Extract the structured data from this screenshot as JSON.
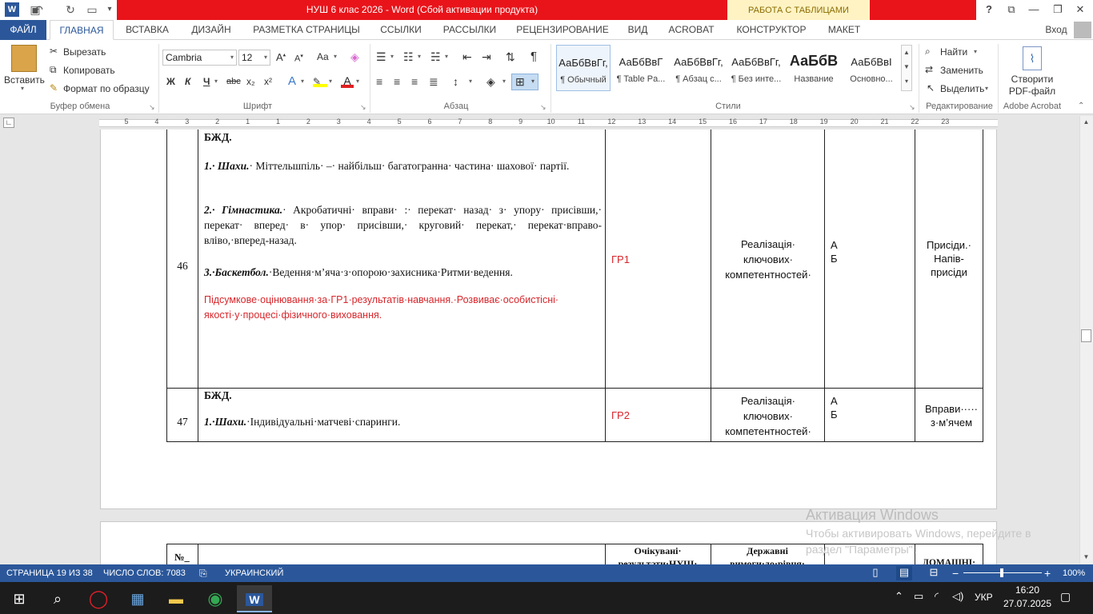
{
  "window": {
    "title": "НУШ 6 клас 2026 -  Word (Сбой активации продукта)",
    "context_tab": "РАБОТА С ТАБЛИЦАМИ",
    "help": "?",
    "signin": "Вход"
  },
  "tabs": [
    "ФАЙЛ",
    "ГЛАВНАЯ",
    "ВСТАВКА",
    "ДИЗАЙН",
    "РАЗМЕТКА СТРАНИЦЫ",
    "ССЫЛКИ",
    "РАССЫЛКИ",
    "РЕЦЕНЗИРОВАНИЕ",
    "ВИД",
    "ACROBAT",
    "КОНСТРУКТОР",
    "МАКЕТ"
  ],
  "clipboard": {
    "paste": "Вставить",
    "cut": "Вырезать",
    "copy": "Копировать",
    "format_painter": "Формат по образцу",
    "label": "Буфер обмена"
  },
  "font": {
    "name": "Cambria",
    "size": "12",
    "label": "Шрифт",
    "bold": "Ж",
    "italic": "К",
    "underline": "Ч",
    "strike": "abc",
    "sub": "x₂",
    "sup": "x²",
    "case": "Aa"
  },
  "paragraph": {
    "label": "Абзац"
  },
  "styles": {
    "label": "Стили",
    "items": [
      {
        "preview": "АаБбВвГг,",
        "name": "¶ Обычный"
      },
      {
        "preview": "АаБбВвГ",
        "name": "¶ Table Pa..."
      },
      {
        "preview": "АаБбВвГг,",
        "name": "¶ Абзац с..."
      },
      {
        "preview": "АаБбВвГг,",
        "name": "¶ Без инте..."
      },
      {
        "preview": "АаБбВ",
        "name": "Название"
      },
      {
        "preview": "АаБбВвІ",
        "name": "Основно..."
      }
    ]
  },
  "editing": {
    "find": "Найти",
    "replace": "Заменить",
    "select": "Выделить",
    "label": "Редактирование"
  },
  "acrobat": {
    "create_pdf_line1": "Створити",
    "create_pdf_line2": "PDF-файл",
    "label": "Adobe Acrobat"
  },
  "ruler_numbers": [
    "5",
    "4",
    "3",
    "2",
    "1",
    "1",
    "2",
    "3",
    "4",
    "5",
    "6",
    "7",
    "8",
    "9",
    "10",
    "11",
    "12",
    "13",
    "14",
    "15",
    "16",
    "17",
    "18",
    "19",
    "20",
    "21",
    "22",
    "23"
  ],
  "rows": [
    {
      "num": "46",
      "heading": "БЖД.",
      "p1_bold": "1.· Шахи.",
      "p1_text": "· Міттельшпіль· –· найбільш· багатогранна· частина· шахової· партії.",
      "p2_bold": "2.· Гімнастика.",
      "p2_text": "· Акробатичні· вправи· :· перекат· назад· з· упору· присівши,· перекат· вперед· в· упор· присівши,· круговий· перекат,· перекат·вправо-вліво,·вперед-назад.",
      "p3_bold": "3.·Баскетбол.",
      "p3_text": "·Ведення·м’яча·з·опорою·захисника·Ритми·ведення.",
      "p4": "Підсумкове·оцінювання·за·ГР1·результатів·навчання.·Розвиває·особистісні· якості·у·процесі·фізичного·виховання.",
      "group": "ГР1",
      "requirement": "Реалізація· ключових· компетентностей·",
      "level_a": "А",
      "level_b": "Б",
      "homework": "Присіди.· Напів- присіди"
    },
    {
      "num": "47",
      "heading": "БЖД.",
      "p1_bold": "1.·Шахи.",
      "p1_text": "·Індивідуальні·матчеві·спаринги.",
      "group": "ГР2",
      "requirement": "Реалізація· ключових· компетентностей·",
      "level_a": "А",
      "level_b": "Б",
      "homework": "Вправи····· з·м’ячем"
    }
  ],
  "next_header": {
    "num": "№_",
    "expected": "Очікувані· результати·НУШ·",
    "state": "Державні вимоги·до·рівня·",
    "homework": "ДОМАШНІ·"
  },
  "activation": {
    "title": "Активация Windows",
    "text": "Чтобы активировать Windows, перейдите в раздел \"Параметры\"."
  },
  "status": {
    "page": "СТРАНИЦА 19 ИЗ 38",
    "words": "ЧИСЛО СЛОВ: 7083",
    "language": "УКРАИНСКИЙ",
    "zoom": "100%"
  },
  "taskbar": {
    "lang": "УКР",
    "time": "16:20",
    "date": "27.07.2025"
  },
  "colors": {
    "accent": "#2b579a",
    "title_red": "#e8141a",
    "doc_red": "#d7262b"
  }
}
